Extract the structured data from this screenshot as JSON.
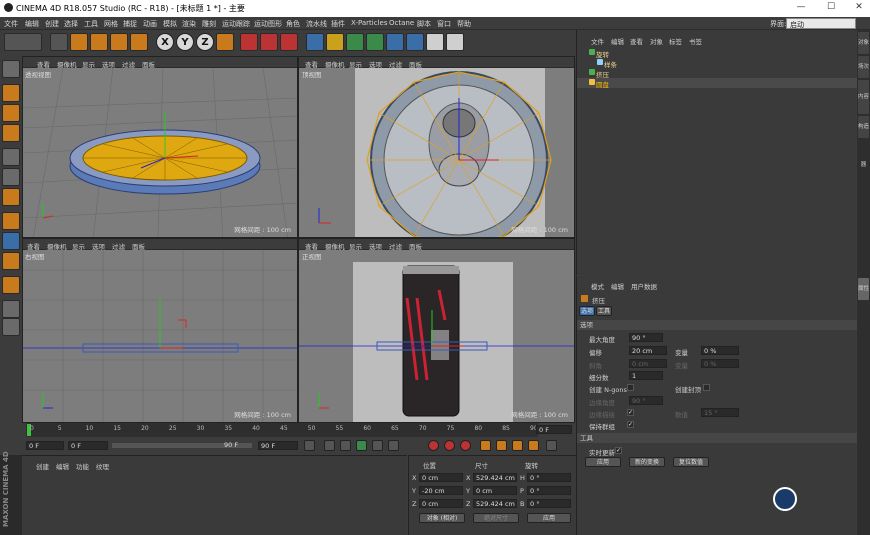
{
  "window": {
    "title": "CINEMA 4D R18.057 Studio (RC - R18) - [未标题 1 *] - 主要",
    "minimize": "—",
    "maximize": "☐",
    "close": "✕"
  },
  "menu": [
    "文件",
    "编辑",
    "创建",
    "选择",
    "工具",
    "网格",
    "捕捉",
    "动画",
    "模拟",
    "渲染",
    "雕刻",
    "运动跟踪",
    "运动图形",
    "角色",
    "流水线",
    "插件",
    "X-Particles",
    "Octane",
    "脚本",
    "窗口",
    "帮助"
  ],
  "layout": {
    "label": "界面:",
    "value": "启动"
  },
  "viewports": [
    {
      "menus": [
        "查看",
        "摄像机",
        "显示",
        "选项",
        "过滤",
        "面板"
      ],
      "name": "透视视图",
      "scale": ""
    },
    {
      "menus": [
        "查看",
        "摄像机",
        "显示",
        "选项",
        "过滤",
        "面板"
      ],
      "name": "顶视图",
      "scale": "网格间距 : 100 cm"
    },
    {
      "menus": [
        "查看",
        "摄像机",
        "显示",
        "选项",
        "过滤",
        "面板"
      ],
      "name": "右视图",
      "scale": "网格间距 : 100 cm"
    },
    {
      "menus": [
        "查看",
        "摄像机",
        "显示",
        "选项",
        "过滤",
        "面板"
      ],
      "name": "正视图",
      "scale": "网格间距 : 100 cm"
    }
  ],
  "persp_scale": "网格间距 : 100 cm",
  "object_manager": {
    "menus": [
      "文件",
      "编辑",
      "查看",
      "对象",
      "标签",
      "书签"
    ],
    "objects": [
      {
        "name": "旋转",
        "color": "#4caf50"
      },
      {
        "name": "样条",
        "color": "#8fd0ff"
      },
      {
        "name": "挤压",
        "color": "#4caf50"
      },
      {
        "name": "圆盘",
        "color": "#f0c040"
      }
    ]
  },
  "side_tabs": [
    "对象",
    "场次",
    "内容浏览器",
    "构造"
  ],
  "attr_side_tab": "属性",
  "attributes": {
    "menus": [
      "模式",
      "编辑",
      "用户数据"
    ],
    "object_name": "挤压",
    "tabs": [
      "选项",
      "工具"
    ],
    "section_options": "选项",
    "fields": {
      "max_angle": {
        "label": "最大角度",
        "value": "90 °"
      },
      "offset": {
        "label": "偏移",
        "value": "20 cm"
      },
      "variance": {
        "label": "变量",
        "value": "0 %"
      },
      "bevel": {
        "label": "斜角",
        "value": "0 cm"
      },
      "variance2": {
        "label": "变量",
        "value": "0 %"
      },
      "subdivision": {
        "label": "细分数",
        "value": "1"
      },
      "create_ngons": {
        "label": "创建 N-gons"
      },
      "create_caps": {
        "label": "创建封顶"
      },
      "edge_angle": {
        "label": "边缘角度",
        "value": "90 °"
      },
      "edge_phong": {
        "label": "边缘描绘"
      },
      "count": {
        "label": "数值",
        "value": "15 °"
      },
      "keep_groups": {
        "label": "保持群组"
      }
    },
    "section_tool": "工具",
    "realtime": {
      "label": "实时更新"
    },
    "buttons": {
      "apply": "应用",
      "new_transform": "新的变换",
      "reset": "复位数值"
    }
  },
  "timeline": {
    "ticks": [
      "0",
      "5",
      "10",
      "15",
      "20",
      "25",
      "30",
      "35",
      "40",
      "45",
      "50",
      "55",
      "60",
      "65",
      "70",
      "75",
      "80",
      "85",
      "90"
    ],
    "current": "0 F",
    "start": "0 F",
    "cur2": "0 F",
    "end_a": "90 F",
    "end_b": "90 F"
  },
  "material_manager": {
    "menus": [
      "创建",
      "编辑",
      "功能",
      "纹理"
    ]
  },
  "maxon": "MAXON CINEMA 4D",
  "coordinates": {
    "headers": [
      "位置",
      "尺寸",
      "旋转"
    ],
    "rows": [
      {
        "axis": "X",
        "pos": "0 cm",
        "saxis": "X",
        "size": "529.424 cm",
        "raxis": "H",
        "rot": "0 °"
      },
      {
        "axis": "Y",
        "pos": "-20 cm",
        "saxis": "Y",
        "size": "0 cm",
        "raxis": "P",
        "rot": "0 °"
      },
      {
        "axis": "Z",
        "pos": "0 cm",
        "saxis": "Z",
        "size": "529.424 cm",
        "raxis": "B",
        "rot": "0 °"
      }
    ],
    "mode": "对象 (相对)",
    "size_mode": "绝对尺寸",
    "apply": "应用"
  },
  "colors": {
    "accent": "#c87a1c",
    "highlight": "#f0b000",
    "bg": "#3c3c3c"
  }
}
